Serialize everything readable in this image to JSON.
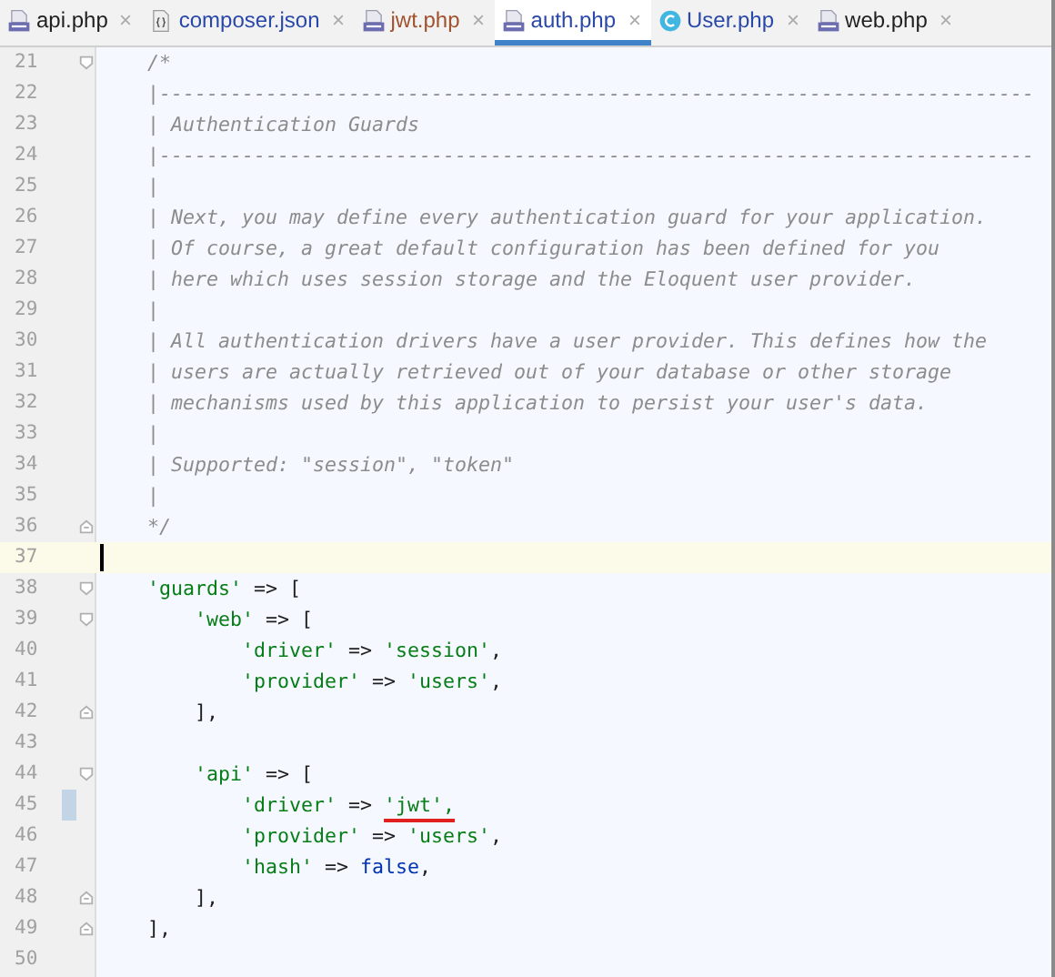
{
  "tabs": [
    {
      "label": "api.php",
      "kind": "php",
      "selected": false,
      "color": "#1f1f1f"
    },
    {
      "label": "composer.json",
      "kind": "json",
      "selected": false,
      "color": "#2a48a8"
    },
    {
      "label": "jwt.php",
      "kind": "php",
      "selected": false,
      "color": "#a0522d"
    },
    {
      "label": "auth.php",
      "kind": "php",
      "selected": true,
      "color": "#2a48a8"
    },
    {
      "label": "User.php",
      "kind": "class",
      "selected": false,
      "color": "#2a48a8"
    },
    {
      "label": "web.php",
      "kind": "php",
      "selected": false,
      "color": "#1f1f1f"
    }
  ],
  "lines": [
    {
      "number": "21",
      "fold_start": true,
      "fold_end": false,
      "current": false,
      "changed": false,
      "segments": [
        {
          "kind": "comment",
          "text": "    /*"
        }
      ]
    },
    {
      "number": "22",
      "fold_start": false,
      "fold_end": false,
      "current": false,
      "changed": false,
      "segments": [
        {
          "kind": "comment",
          "text": "    |--------------------------------------------------------------------------"
        }
      ]
    },
    {
      "number": "23",
      "fold_start": false,
      "fold_end": false,
      "current": false,
      "changed": false,
      "segments": [
        {
          "kind": "comment",
          "text": "    | Authentication Guards"
        }
      ]
    },
    {
      "number": "24",
      "fold_start": false,
      "fold_end": false,
      "current": false,
      "changed": false,
      "segments": [
        {
          "kind": "comment",
          "text": "    |--------------------------------------------------------------------------"
        }
      ]
    },
    {
      "number": "25",
      "fold_start": false,
      "fold_end": false,
      "current": false,
      "changed": false,
      "segments": [
        {
          "kind": "comment",
          "text": "    |"
        }
      ]
    },
    {
      "number": "26",
      "fold_start": false,
      "fold_end": false,
      "current": false,
      "changed": false,
      "segments": [
        {
          "kind": "comment",
          "text": "    | Next, you may define every authentication guard for your application."
        }
      ]
    },
    {
      "number": "27",
      "fold_start": false,
      "fold_end": false,
      "current": false,
      "changed": false,
      "segments": [
        {
          "kind": "comment",
          "text": "    | Of course, a great default configuration has been defined for you"
        }
      ]
    },
    {
      "number": "28",
      "fold_start": false,
      "fold_end": false,
      "current": false,
      "changed": false,
      "segments": [
        {
          "kind": "comment",
          "text": "    | here which uses session storage and the Eloquent user provider."
        }
      ]
    },
    {
      "number": "29",
      "fold_start": false,
      "fold_end": false,
      "current": false,
      "changed": false,
      "segments": [
        {
          "kind": "comment",
          "text": "    |"
        }
      ]
    },
    {
      "number": "30",
      "fold_start": false,
      "fold_end": false,
      "current": false,
      "changed": false,
      "segments": [
        {
          "kind": "comment",
          "text": "    | All authentication drivers have a user provider. This defines how the"
        }
      ]
    },
    {
      "number": "31",
      "fold_start": false,
      "fold_end": false,
      "current": false,
      "changed": false,
      "segments": [
        {
          "kind": "comment",
          "text": "    | users are actually retrieved out of your database or other storage"
        }
      ]
    },
    {
      "number": "32",
      "fold_start": false,
      "fold_end": false,
      "current": false,
      "changed": false,
      "segments": [
        {
          "kind": "comment",
          "text": "    | mechanisms used by this application to persist your user's data."
        }
      ]
    },
    {
      "number": "33",
      "fold_start": false,
      "fold_end": false,
      "current": false,
      "changed": false,
      "segments": [
        {
          "kind": "comment",
          "text": "    |"
        }
      ]
    },
    {
      "number": "34",
      "fold_start": false,
      "fold_end": false,
      "current": false,
      "changed": false,
      "segments": [
        {
          "kind": "comment",
          "text": "    | Supported: \"session\", \"token\""
        }
      ]
    },
    {
      "number": "35",
      "fold_start": false,
      "fold_end": false,
      "current": false,
      "changed": false,
      "segments": [
        {
          "kind": "comment",
          "text": "    |"
        }
      ]
    },
    {
      "number": "36",
      "fold_start": false,
      "fold_end": true,
      "current": false,
      "changed": false,
      "segments": [
        {
          "kind": "comment",
          "text": "    */"
        }
      ]
    },
    {
      "number": "37",
      "fold_start": false,
      "fold_end": false,
      "current": true,
      "changed": false
    },
    {
      "number": "38",
      "fold_start": true,
      "fold_end": false,
      "current": false,
      "changed": false,
      "segments": [
        {
          "kind": "string",
          "text": "    'guards'"
        },
        {
          "kind": "op",
          "text": " => ["
        }
      ]
    },
    {
      "number": "39",
      "fold_start": true,
      "fold_end": false,
      "current": false,
      "changed": false,
      "segments": [
        {
          "kind": "string",
          "text": "        'web'"
        },
        {
          "kind": "op",
          "text": " => ["
        }
      ]
    },
    {
      "number": "40",
      "fold_start": false,
      "fold_end": false,
      "current": false,
      "changed": false,
      "segments": [
        {
          "kind": "string",
          "text": "            'driver'"
        },
        {
          "kind": "op",
          "text": " => "
        },
        {
          "kind": "string",
          "text": "'session'"
        },
        {
          "kind": "op",
          "text": ","
        }
      ]
    },
    {
      "number": "41",
      "fold_start": false,
      "fold_end": false,
      "current": false,
      "changed": false,
      "segments": [
        {
          "kind": "string",
          "text": "            'provider'"
        },
        {
          "kind": "op",
          "text": " => "
        },
        {
          "kind": "string",
          "text": "'users'"
        },
        {
          "kind": "op",
          "text": ","
        }
      ]
    },
    {
      "number": "42",
      "fold_start": false,
      "fold_end": true,
      "current": false,
      "changed": false,
      "segments": [
        {
          "kind": "op",
          "text": "        ],"
        }
      ]
    },
    {
      "number": "43",
      "fold_start": false,
      "fold_end": false,
      "current": false,
      "changed": false
    },
    {
      "number": "44",
      "fold_start": true,
      "fold_end": false,
      "current": false,
      "changed": false,
      "segments": [
        {
          "kind": "string",
          "text": "        'api'"
        },
        {
          "kind": "op",
          "text": " => ["
        }
      ]
    },
    {
      "number": "45",
      "fold_start": false,
      "fold_end": false,
      "current": false,
      "changed": true,
      "segments": [
        {
          "kind": "string",
          "text": "            'driver'"
        },
        {
          "kind": "op",
          "text": " => "
        },
        {
          "kind": "string",
          "text": "'jwt',",
          "underlined": true
        }
      ]
    },
    {
      "number": "46",
      "fold_start": false,
      "fold_end": false,
      "current": false,
      "changed": false,
      "segments": [
        {
          "kind": "string",
          "text": "            'provider'"
        },
        {
          "kind": "op",
          "text": " => "
        },
        {
          "kind": "string",
          "text": "'users'"
        },
        {
          "kind": "op",
          "text": ","
        }
      ]
    },
    {
      "number": "47",
      "fold_start": false,
      "fold_end": false,
      "current": false,
      "changed": false,
      "segments": [
        {
          "kind": "string",
          "text": "            'hash'"
        },
        {
          "kind": "op",
          "text": " => "
        },
        {
          "kind": "keyword",
          "text": "false"
        },
        {
          "kind": "op",
          "text": ","
        }
      ]
    },
    {
      "number": "48",
      "fold_start": false,
      "fold_end": true,
      "current": false,
      "changed": false,
      "segments": [
        {
          "kind": "op",
          "text": "        ],"
        }
      ]
    },
    {
      "number": "49",
      "fold_start": false,
      "fold_end": true,
      "current": false,
      "changed": false,
      "segments": [
        {
          "kind": "op",
          "text": "    ],"
        }
      ]
    },
    {
      "number": "50",
      "fold_start": false,
      "fold_end": false,
      "current": false,
      "changed": false
    }
  ]
}
